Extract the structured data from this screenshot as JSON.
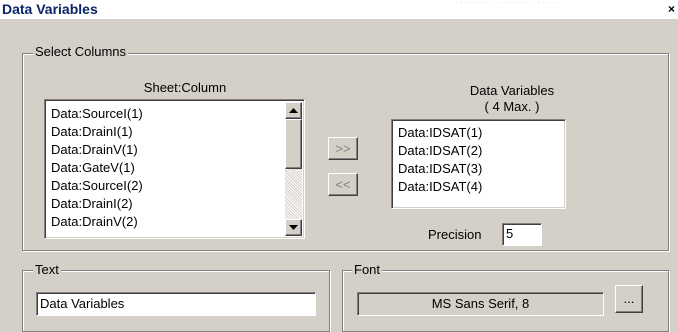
{
  "window": {
    "title": "Data Variables",
    "close_glyph": "×",
    "ghost_text": "........ ........ ......"
  },
  "select_columns": {
    "legend": "Select Columns",
    "sheet_column_label": "Sheet:Column",
    "data_variables_label": "Data Variables",
    "max_label": "( 4 Max. )",
    "sheet_items": [
      "Data:SourceI(1)",
      "Data:DrainI(1)",
      "Data:DrainV(1)",
      "Data:GateV(1)",
      "Data:SourceI(2)",
      "Data:DrainI(2)",
      "Data:DrainV(2)"
    ],
    "data_items": [
      "Data:IDSAT(1)",
      "Data:IDSAT(2)",
      "Data:IDSAT(3)",
      "Data:IDSAT(4)"
    ],
    "add_button": ">>",
    "remove_button": "<<",
    "precision_label": "Precision",
    "precision_value": "5"
  },
  "text_group": {
    "legend": "Text",
    "value": "Data Variables"
  },
  "font_group": {
    "legend": "Font",
    "font_value": "MS Sans Serif, 8",
    "browse_button": "..."
  },
  "icons": {
    "scroll_up": "scroll-up-arrow-icon",
    "scroll_down": "scroll-down-arrow-icon",
    "close": "close-icon"
  },
  "colors": {
    "window_bg": "#d4d0c8",
    "title_text": "#0a246a"
  }
}
